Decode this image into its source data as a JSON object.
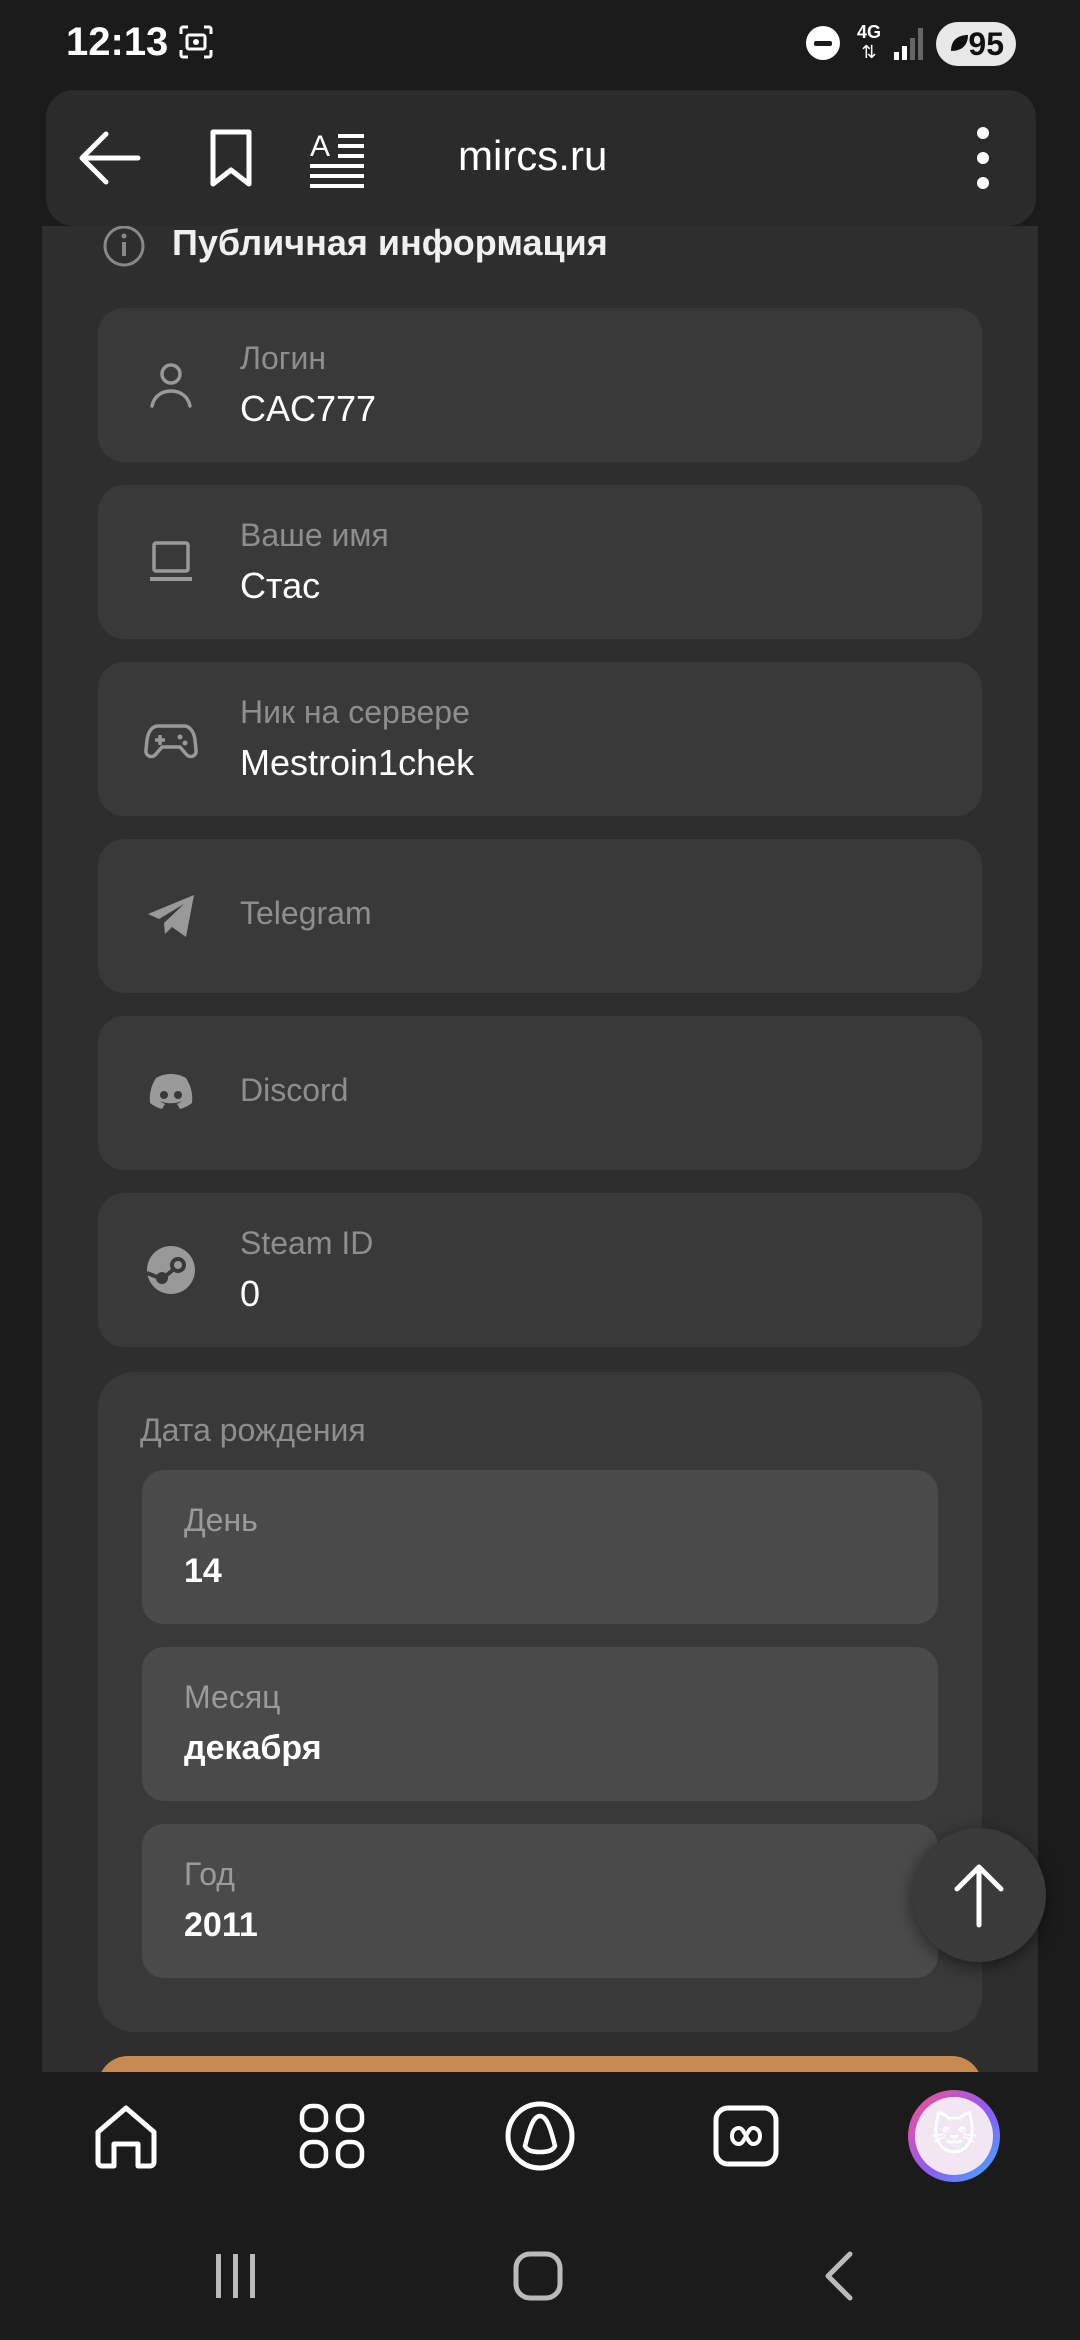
{
  "status_bar": {
    "time": "12:13",
    "network": "4G",
    "battery": "95"
  },
  "browser": {
    "url": "mircs.ru"
  },
  "section": {
    "title": "Публичная информация"
  },
  "fields": [
    {
      "label": "Логин",
      "value": "CAC777",
      "icon": "user-icon"
    },
    {
      "label": "Ваше имя",
      "value": "Стас",
      "icon": "laptop-icon"
    },
    {
      "label": "Ник на сервере",
      "value": "Mestroin1chek",
      "icon": "gamepad-icon"
    },
    {
      "label": "Telegram",
      "value": "",
      "icon": "telegram-icon"
    },
    {
      "label": "Discord",
      "value": "",
      "icon": "discord-icon"
    },
    {
      "label": "Steam ID",
      "value": "0",
      "icon": "steam-icon"
    }
  ],
  "birthdate": {
    "title": "Дата рождения",
    "day_label": "День",
    "day_value": "14",
    "month_label": "Месяц",
    "month_value": "декабря",
    "year_label": "Год",
    "year_value": "2011"
  },
  "colors": {
    "background": "#1b1b1b",
    "panel": "#2e2e2e",
    "field": "#393939",
    "accent_orange": "#c98a52"
  }
}
